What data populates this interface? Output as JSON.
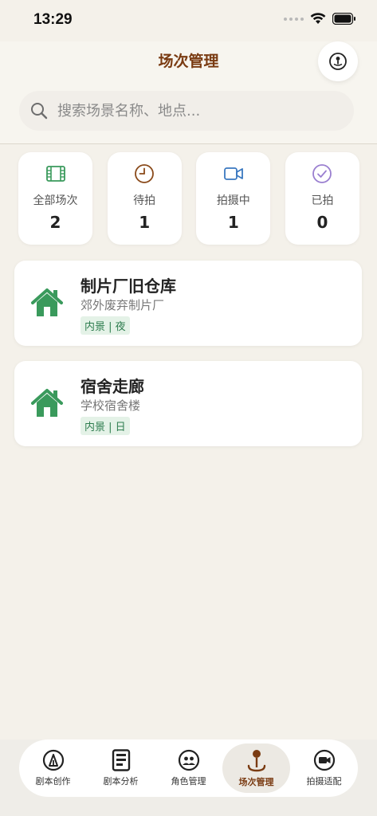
{
  "status": {
    "time": "13:29"
  },
  "header": {
    "title": "场次管理"
  },
  "search": {
    "placeholder": "搜索场景名称、地点..."
  },
  "stats": [
    {
      "label": "全部场次",
      "value": "2",
      "icon": "film-icon",
      "color": "#3a9a5c"
    },
    {
      "label": "待拍",
      "value": "1",
      "icon": "clock-icon",
      "color": "#8a4a1a"
    },
    {
      "label": "拍摄中",
      "value": "1",
      "icon": "video-icon",
      "color": "#3a78c0"
    },
    {
      "label": "已拍",
      "value": "0",
      "icon": "check-circle-icon",
      "color": "#9a7fd0"
    }
  ],
  "scenes": [
    {
      "title": "制片厂旧仓库",
      "location": "郊外废弃制片厂",
      "tag": "内景 | 夜",
      "icon": "house-icon"
    },
    {
      "title": "宿舍走廊",
      "location": "学校宿舍楼",
      "tag": "内景 | 日",
      "icon": "house-icon"
    }
  ],
  "tabs": [
    {
      "label": "剧本创作",
      "icon": "pen-icon"
    },
    {
      "label": "剧本分析",
      "icon": "document-icon"
    },
    {
      "label": "角色管理",
      "icon": "people-icon"
    },
    {
      "label": "场次管理",
      "icon": "location-pin-icon",
      "active": true
    },
    {
      "label": "拍摄适配",
      "icon": "camera-icon"
    }
  ],
  "colors": {
    "accent": "#7a3b12",
    "green": "#3a9a5c",
    "background": "#f4f1ea"
  }
}
